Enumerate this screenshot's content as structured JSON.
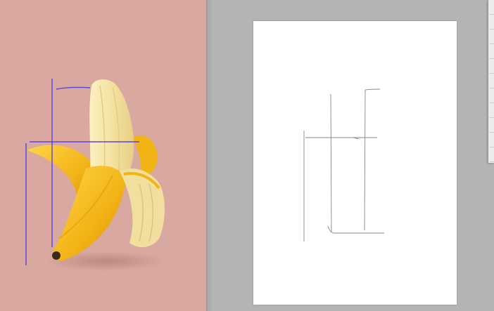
{
  "reference_image": {
    "subject": "peeled banana",
    "background_color": "#d8a8a1",
    "guide_color": "#5a44d6"
  },
  "drawing_canvas": {
    "background_color": "#ffffff",
    "sketch_color": "#7a7a7a"
  },
  "side_panel": {
    "items": [
      "",
      "",
      "",
      "",
      "",
      "",
      "",
      "",
      "",
      "",
      ""
    ]
  }
}
